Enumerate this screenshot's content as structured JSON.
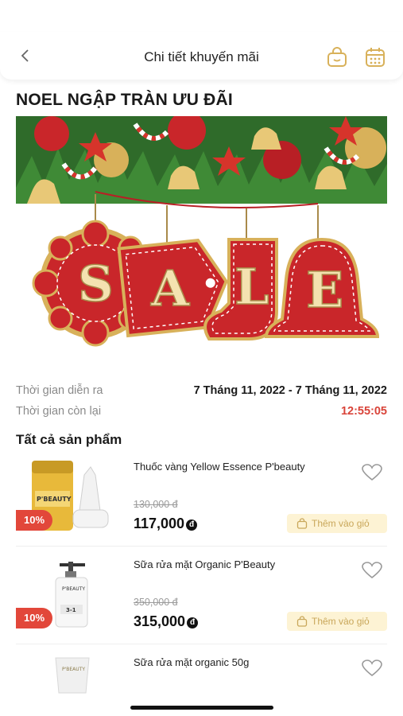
{
  "header": {
    "title": "Chi tiết khuyến mãi",
    "back_icon": "chevron-left-icon",
    "icons": [
      "shopping-bag-icon",
      "calendar-icon"
    ],
    "accent": "#d8b15a"
  },
  "promo": {
    "title": "NOEL NGẬP TRÀN ƯU ĐÃI",
    "banner_text": "SALE"
  },
  "info": {
    "duration_label": "Thời gian diễn ra",
    "duration_value": "7 Tháng 11, 2022 - 7 Tháng 11, 2022",
    "remaining_label": "Thời gian còn lại",
    "remaining_value": "12:55:05"
  },
  "products_section": {
    "title": "Tất cả sản phẩm",
    "add_to_cart_label": "Thêm vào giỏ",
    "items": [
      {
        "name": "Thuốc vàng Yellow Essence P'beauty",
        "old_price": "130,000 đ",
        "price": "117,000",
        "currency": "đ",
        "discount": "10%"
      },
      {
        "name": "Sữa rửa mặt Organic P'Beauty",
        "old_price": "350,000 đ",
        "price": "315,000",
        "currency": "đ",
        "discount": "10%"
      },
      {
        "name": "Sữa rửa mặt organic 50g"
      }
    ]
  },
  "colors": {
    "discount": "#e2473a",
    "countdown": "#d9443a",
    "cart_bg": "#fdf3d4"
  }
}
